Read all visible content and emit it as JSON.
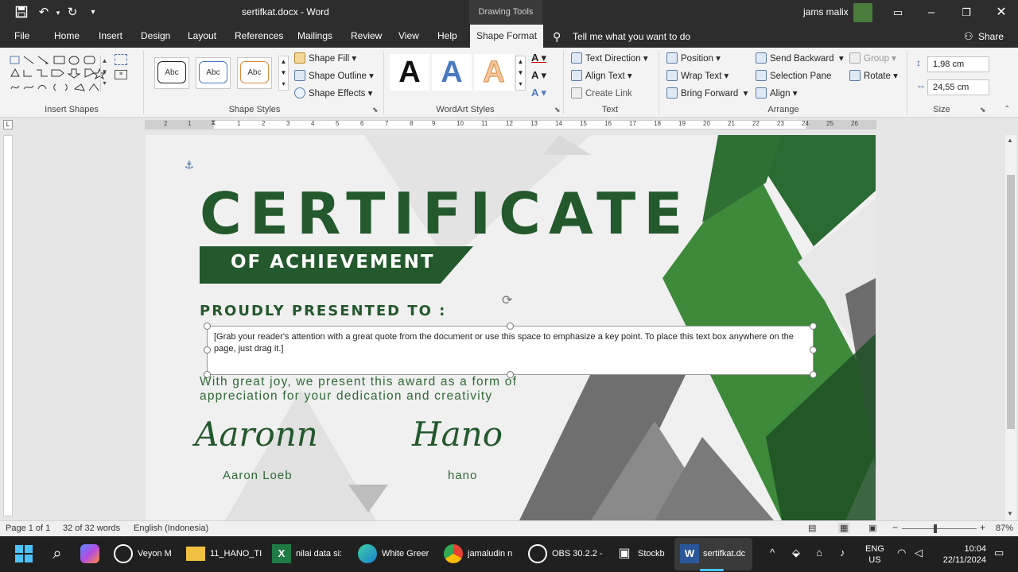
{
  "titlebar": {
    "doc_title": "sertifkat.docx  -  Word",
    "context_title": "Drawing Tools",
    "user": "jams malix"
  },
  "tabs": [
    "File",
    "Home",
    "Insert",
    "Design",
    "Layout",
    "References",
    "Mailings",
    "Review",
    "View",
    "Help"
  ],
  "active_tab": "Shape Format",
  "tell_me": "Tell me what you want to do",
  "share": "Share",
  "ribbon": {
    "insert_shapes": {
      "label": "Insert Shapes"
    },
    "shape_styles": {
      "label": "Shape Styles",
      "samples": [
        "Abc",
        "Abc",
        "Abc"
      ],
      "fill": "Shape Fill",
      "outline": "Shape Outline",
      "effects": "Shape Effects"
    },
    "wordart": {
      "label": "WordArt Styles",
      "letter": "A"
    },
    "text": {
      "label": "Text",
      "direction": "Text Direction",
      "align": "Align Text",
      "link": "Create Link"
    },
    "arrange": {
      "label": "Arrange",
      "position": "Position",
      "wrap": "Wrap Text",
      "forward": "Bring Forward",
      "backward": "Send Backward",
      "selection": "Selection Pane",
      "align": "Align",
      "group": "Group",
      "rotate": "Rotate"
    },
    "size": {
      "label": "Size",
      "height": "1,98 cm",
      "width": "24,55 cm"
    }
  },
  "ruler": {
    "marks": [
      "2",
      "1",
      "1",
      "2",
      "3",
      "4",
      "5",
      "6",
      "7",
      "8",
      "9",
      "10",
      "11",
      "12",
      "13",
      "14",
      "15",
      "16",
      "17",
      "18",
      "19",
      "20",
      "21",
      "22",
      "23",
      "24",
      "25",
      "26"
    ]
  },
  "certificate": {
    "title": "CERTIFICATE",
    "subtitle": "OF ACHIEVEMENT",
    "presented": "PROUDLY PRESENTED TO :",
    "quote": "[Grab your reader's attention with a great quote from the document or use this space to emphasize a key point. To place this text box anywhere on the page, just drag it.]",
    "message_line1": "With great joy, we present this award as a form of",
    "message_line2": "appreciation for your dedication and creativity",
    "sig1_script": "Aaronn",
    "sig1_name": "Aaron Loeb",
    "sig2_script": "Hano",
    "sig2_name": "hano",
    "colors": {
      "green_dark": "#23592c",
      "green_mid": "#3d7f3a",
      "gray": "#6e6e6e"
    }
  },
  "status": {
    "page": "Page 1 of 1",
    "words": "32 of 32 words",
    "language": "English (Indonesia)",
    "zoom": "87%"
  },
  "taskbar": {
    "apps": [
      {
        "label": "Veyon M"
      },
      {
        "label": "11_HANO_TI"
      },
      {
        "label": "nilai data si:"
      },
      {
        "label": "White Greer"
      },
      {
        "label": "jamaludin n"
      },
      {
        "label": "OBS 30.2.2 -"
      },
      {
        "label": "Stockb"
      },
      {
        "label": "sertifkat.dc"
      }
    ],
    "lang1": "ENG",
    "lang2": "US",
    "time": "10:04",
    "date": "22/11/2024"
  }
}
